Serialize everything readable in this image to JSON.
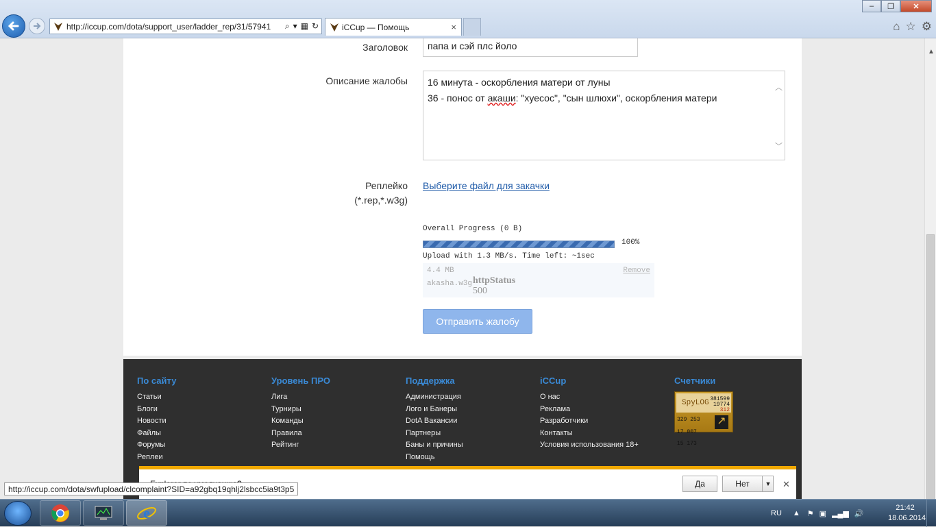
{
  "browser": {
    "url": "http://iccup.com/dota/support_user/ladder_rep/31/57941",
    "tab_title": "iCCup — Помощь",
    "tab_close": "×",
    "status_url": "http://iccup.com/dota/swfupload/clcomplaint?SID=a92gbq19qhlj2lsbcc5ia9t3p5"
  },
  "form": {
    "title_label": "Заголовок",
    "title_value": "папа и сэй плс йоло",
    "desc_label": "Описание жалобы",
    "desc_line1": "16 минута - оскорбления матери от луны",
    "desc_line2_a": "36 - понос от ",
    "desc_line2_misspelled": "акаши",
    "desc_line2_b": ": \"хуесос\", \"сын шлюхи\", оскорбления матери",
    "replay_label_1": "Реплейко",
    "replay_label_2": "(*.rep,*.w3g)",
    "file_link": "Выберите файл для закачки",
    "submit": "Отправить жалобу"
  },
  "upload": {
    "overall": "Overall Progress (0 B)",
    "percent": "100%",
    "progress": 1.0,
    "speed": "Upload with 1.3 MB/s. Time left: ~1sec",
    "file_size": "4.4 MB",
    "file_name": "akasha.w3g",
    "remove": "Remove",
    "status_label": "httpStatus",
    "status_code": "500"
  },
  "footer": {
    "col1": {
      "title": "По сайту",
      "items": [
        "Статьи",
        "Блоги",
        "Новости",
        "Файлы",
        "Форумы",
        "Реплеи"
      ]
    },
    "col2": {
      "title": "Уровень ПРО",
      "items": [
        "Лига",
        "Турниры",
        "Команды",
        "Правила",
        "Рейтинг"
      ]
    },
    "col3": {
      "title": "Поддержка",
      "items": [
        "Администрация",
        "Лого и Банеры",
        "DotA Вакансии",
        "Партнеры",
        "Баны и причины",
        "Помощь"
      ]
    },
    "col4": {
      "title": "iCCup",
      "items": [
        "О нас",
        "Реклама",
        "Разработчики",
        "Контакты",
        "Условия использования 18+"
      ]
    },
    "col5": {
      "title": "Счетчики"
    },
    "counter": {
      "logo": "SpyLOG",
      "n1": "381599",
      "n2": "19774",
      "n3": "312",
      "b1": "329 253",
      "b2": "17 007",
      "b3": "15 173"
    }
  },
  "notification": {
    "text": "Explorer по умолчанию?",
    "yes": "Да",
    "no": "Нет"
  },
  "taskbar": {
    "lang": "RU",
    "time": "21:42",
    "date": "18.06.2014"
  }
}
